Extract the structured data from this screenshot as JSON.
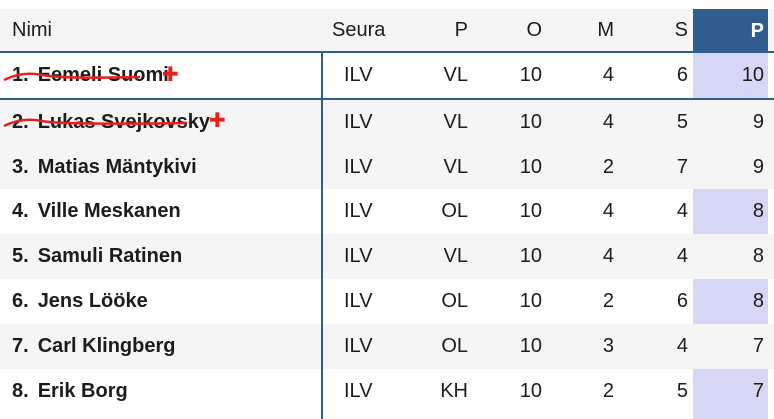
{
  "table": {
    "headers": {
      "name": "Nimi",
      "club": "Seura",
      "position": "P",
      "games": "O",
      "goals": "M",
      "assists": "S",
      "points": "P"
    },
    "rows": [
      {
        "rank": "1.",
        "name": "Eemeli Suomi",
        "club": "ILV",
        "position": "VL",
        "games": "10",
        "goals": "4",
        "assists": "6",
        "points": "10",
        "struck_out": true
      },
      {
        "rank": "2.",
        "name": "Lukas Svejkovsky",
        "club": "ILV",
        "position": "VL",
        "games": "10",
        "goals": "4",
        "assists": "5",
        "points": "9",
        "struck_out": true
      },
      {
        "rank": "3.",
        "name": "Matias Mäntykivi",
        "club": "ILV",
        "position": "VL",
        "games": "10",
        "goals": "2",
        "assists": "7",
        "points": "9",
        "struck_out": false
      },
      {
        "rank": "4.",
        "name": "Ville Meskanen",
        "club": "ILV",
        "position": "OL",
        "games": "10",
        "goals": "4",
        "assists": "4",
        "points": "8",
        "struck_out": false
      },
      {
        "rank": "5.",
        "name": "Samuli Ratinen",
        "club": "ILV",
        "position": "VL",
        "games": "10",
        "goals": "4",
        "assists": "4",
        "points": "8",
        "struck_out": false
      },
      {
        "rank": "6.",
        "name": "Jens Lööke",
        "club": "ILV",
        "position": "OL",
        "games": "10",
        "goals": "2",
        "assists": "6",
        "points": "8",
        "struck_out": false
      },
      {
        "rank": "7.",
        "name": "Carl Klingberg",
        "club": "ILV",
        "position": "OL",
        "games": "10",
        "goals": "3",
        "assists": "4",
        "points": "7",
        "struck_out": false
      },
      {
        "rank": "8.",
        "name": "Erik Borg",
        "club": "ILV",
        "position": "KH",
        "games": "10",
        "goals": "2",
        "assists": "5",
        "points": "7",
        "struck_out": false
      }
    ]
  },
  "colors": {
    "header_blue": "#2e5d8e",
    "points_column": "#d6d6f7",
    "strike_red": "#e8201c",
    "stripe": "#f5f5f5"
  },
  "icons": {
    "strike_mark": "red-cross-icon"
  }
}
